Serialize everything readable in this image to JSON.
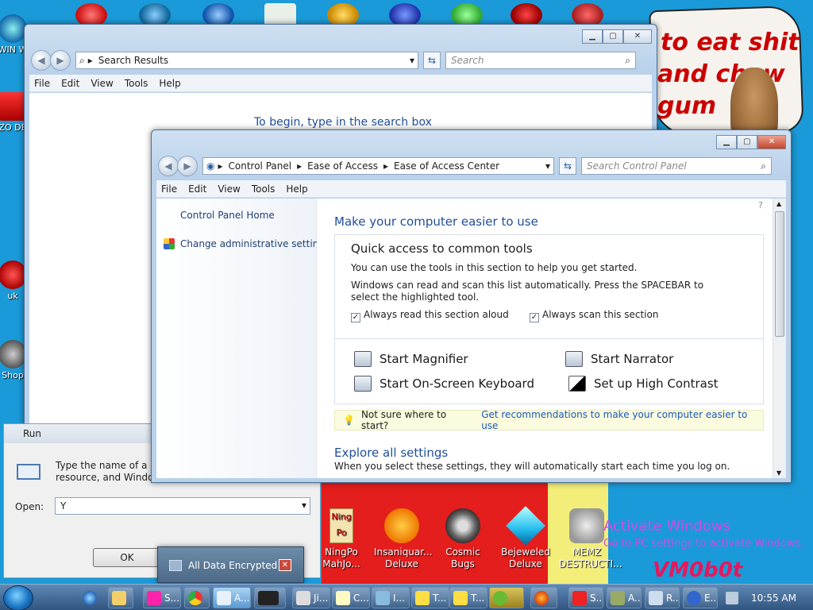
{
  "desktop": {
    "left_labels": [
      "WIN W",
      "ZO DE",
      "uk",
      "Shop"
    ],
    "meme": {
      "line1": "to eat shit",
      "line2": "and chew",
      "line3": "gum"
    },
    "games": [
      {
        "label": "NingPo MahJo...",
        "glyph_text": "Ning Po"
      },
      {
        "label": "Insaniquar... Deluxe"
      },
      {
        "label": "Cosmic Bugs"
      },
      {
        "label": "Bejeweled Deluxe"
      },
      {
        "label": "MEMZ DESTRUCTI..."
      }
    ],
    "activate": {
      "title": "Activate Windows",
      "subtitle": "Go to PC settings to activate Windows."
    },
    "watermark": "VM0b0t"
  },
  "search_window": {
    "address": "Search Results",
    "search_placeholder": "Search",
    "menu": [
      "File",
      "Edit",
      "View",
      "Tools",
      "Help"
    ],
    "hint": "To begin, type in the search box"
  },
  "cp_window": {
    "breadcrumb": [
      "Control Panel",
      "Ease of Access",
      "Ease of Access Center"
    ],
    "search_placeholder": "Search Control Panel",
    "menu": [
      "File",
      "Edit",
      "View",
      "Tools",
      "Help"
    ],
    "left_links": [
      "Control Panel Home",
      "Change administrative settings"
    ],
    "heading": "Make your computer easier to use",
    "quick": {
      "title": "Quick access to common tools",
      "line1": "You can use the tools in this section to help you get started.",
      "line2": "Windows can read and scan this list automatically.  Press the SPACEBAR to select the highlighted tool.",
      "check1": "Always read this section aloud",
      "check2": "Always scan this section"
    },
    "tools": [
      "Start Magnifier",
      "Start Narrator",
      "Start On-Screen Keyboard",
      "Set up High Contrast"
    ],
    "tip_text": "Not sure where to start?",
    "tip_link": "Get recommendations to make your computer easier to use",
    "explore_title": "Explore all settings",
    "explore_text": "When you select these settings, they will automatically start each time you log on."
  },
  "run_dialog": {
    "title": "Run",
    "desc_line1": "Type the name of a pro",
    "desc_line2": "resource, and Windows",
    "open_label": "Open:",
    "open_value": "Y",
    "ok_label": "OK"
  },
  "encrypted_popup": {
    "text": "All Data Encrypted"
  },
  "taskbar": {
    "items": [
      "S...",
      "A...",
      "",
      "Ji...",
      "C...",
      "I...",
      "T...",
      "T...",
      "",
      "",
      "S...",
      "A...",
      "R...",
      "E..."
    ],
    "clock": "10:55 AM"
  }
}
